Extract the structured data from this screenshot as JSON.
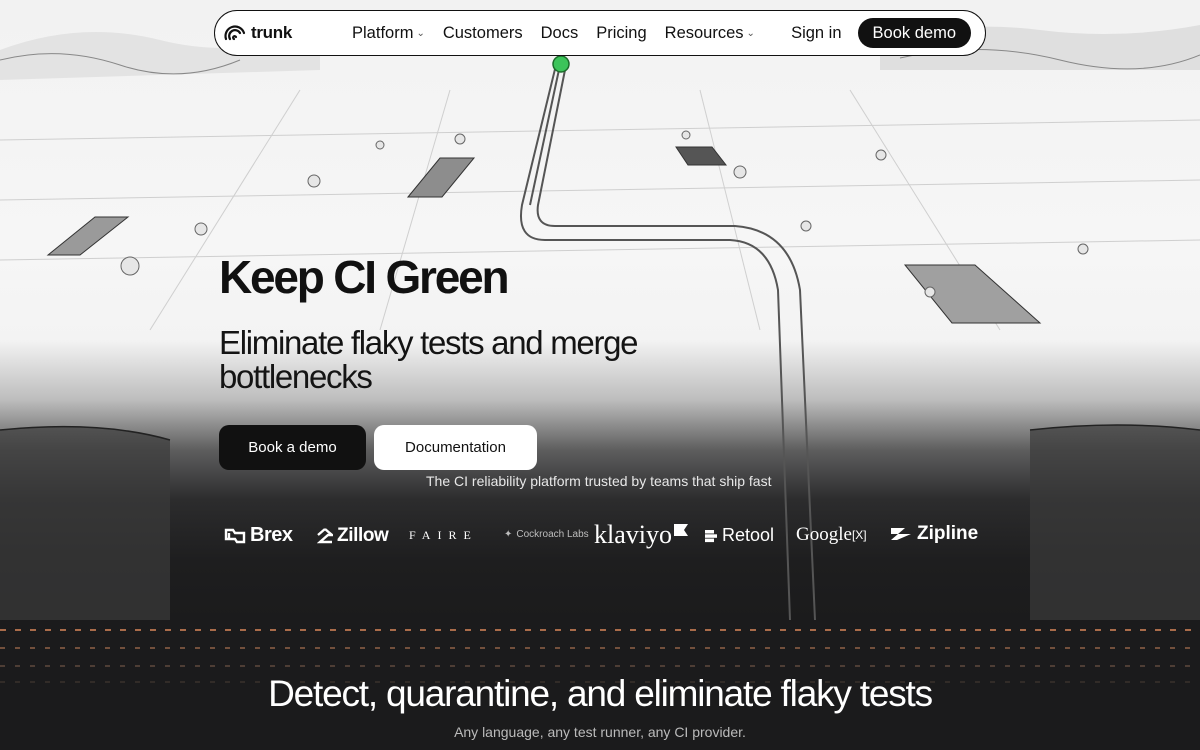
{
  "nav": {
    "brand": "trunk",
    "links": [
      {
        "label": "Platform",
        "dropdown": true
      },
      {
        "label": "Customers",
        "dropdown": false
      },
      {
        "label": "Docs",
        "dropdown": false
      },
      {
        "label": "Pricing",
        "dropdown": false
      },
      {
        "label": "Resources",
        "dropdown": true
      }
    ],
    "sign_in": "Sign in",
    "cta": "Book demo"
  },
  "hero": {
    "title": "Keep CI Green",
    "subtitle": "Eliminate flaky tests and merge bottlenecks",
    "primary_button": "Book a demo",
    "secondary_button": "Documentation",
    "trusted_text": "The CI reliability platform trusted by teams that ship fast"
  },
  "customer_logos": [
    {
      "name": "Brex",
      "icon": "brex-logo-icon"
    },
    {
      "name": "Zillow",
      "icon": "zillow-logo-icon"
    },
    {
      "name": "FAIRE"
    },
    {
      "name": "Cockroach Labs",
      "icon": "cockroach-icon"
    },
    {
      "name": "klaviyo",
      "icon": "klaviyo-flag-icon"
    },
    {
      "name": "Retool",
      "icon": "retool-logo-icon"
    },
    {
      "name": "Google",
      "suffix": "[X]"
    },
    {
      "name": "Zipline",
      "icon": "zipline-logo-icon"
    }
  ],
  "section": {
    "title": "Detect, quarantine, and eliminate flaky tests",
    "subtitle": "Any language, any test runner, any CI provider."
  },
  "colors": {
    "accent_dots": "#d9885a",
    "pipe_node": "#3cc45a",
    "dark_bg": "#1b1b1c",
    "button_dark": "#111111"
  }
}
